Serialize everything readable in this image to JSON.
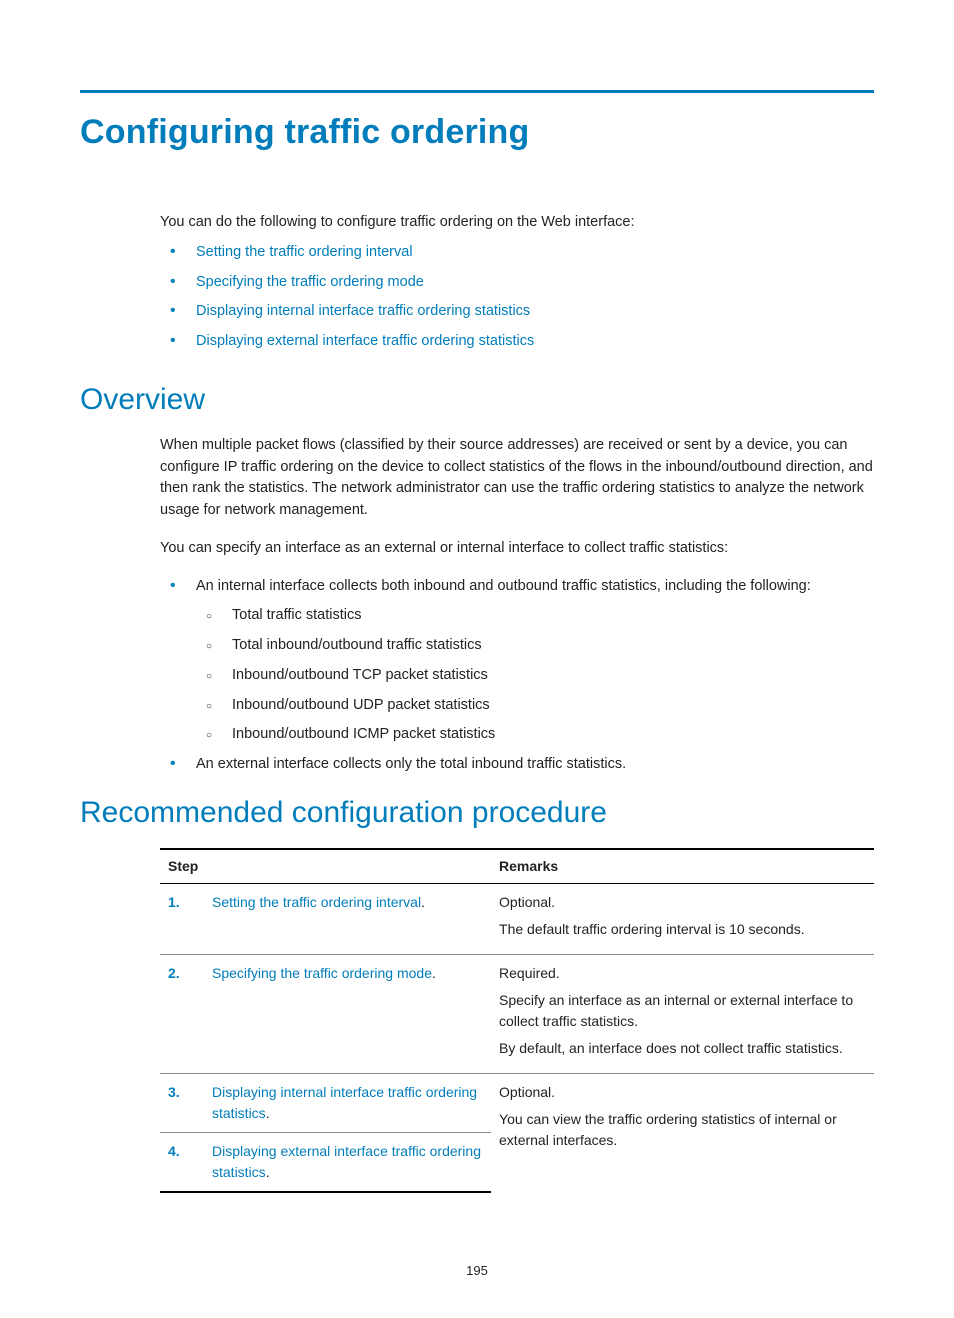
{
  "title": "Configuring traffic ordering",
  "intro": "You can do the following to configure traffic ordering on the Web interface:",
  "intro_links": [
    "Setting the traffic ordering interval",
    "Specifying the traffic ordering mode",
    "Displaying internal interface traffic ordering statistics",
    "Displaying external interface traffic ordering statistics"
  ],
  "overview": {
    "heading": "Overview",
    "para1": "When multiple packet flows (classified by their source addresses) are received or sent by a device, you can configure IP traffic ordering on the device to collect statistics of the flows in the inbound/outbound direction, and then rank the statistics. The network administrator can use the traffic ordering statistics to analyze the network usage for network management.",
    "para2": "You can specify an interface as an external or internal interface to collect traffic statistics:",
    "bullet1": "An internal interface collects both inbound and outbound traffic statistics, including the following:",
    "sub": [
      "Total traffic statistics",
      "Total inbound/outbound traffic statistics",
      "Inbound/outbound TCP packet statistics",
      "Inbound/outbound UDP packet statistics",
      "Inbound/outbound ICMP packet statistics"
    ],
    "bullet2": "An external interface collects only the total inbound traffic statistics."
  },
  "procedure": {
    "heading": "Recommended configuration procedure",
    "headers": {
      "step": "Step",
      "remarks": "Remarks"
    },
    "rows": [
      {
        "num": "1.",
        "link": "Setting the traffic ordering interval",
        "remarks": [
          "Optional.",
          "The default traffic ordering interval is 10 seconds."
        ]
      },
      {
        "num": "2.",
        "link": "Specifying the traffic ordering mode",
        "remarks": [
          "Required.",
          "Specify an interface as an internal or external interface to collect traffic statistics.",
          "By default, an interface does not collect traffic statistics."
        ]
      },
      {
        "num": "3.",
        "link": "Displaying internal interface traffic ordering statistics",
        "remarks_shared": [
          "Optional.",
          "You can view the traffic ordering statistics of internal or external interfaces."
        ]
      },
      {
        "num": "4.",
        "link": "Displaying external interface traffic ordering statistics"
      }
    ]
  },
  "page_number": "195"
}
